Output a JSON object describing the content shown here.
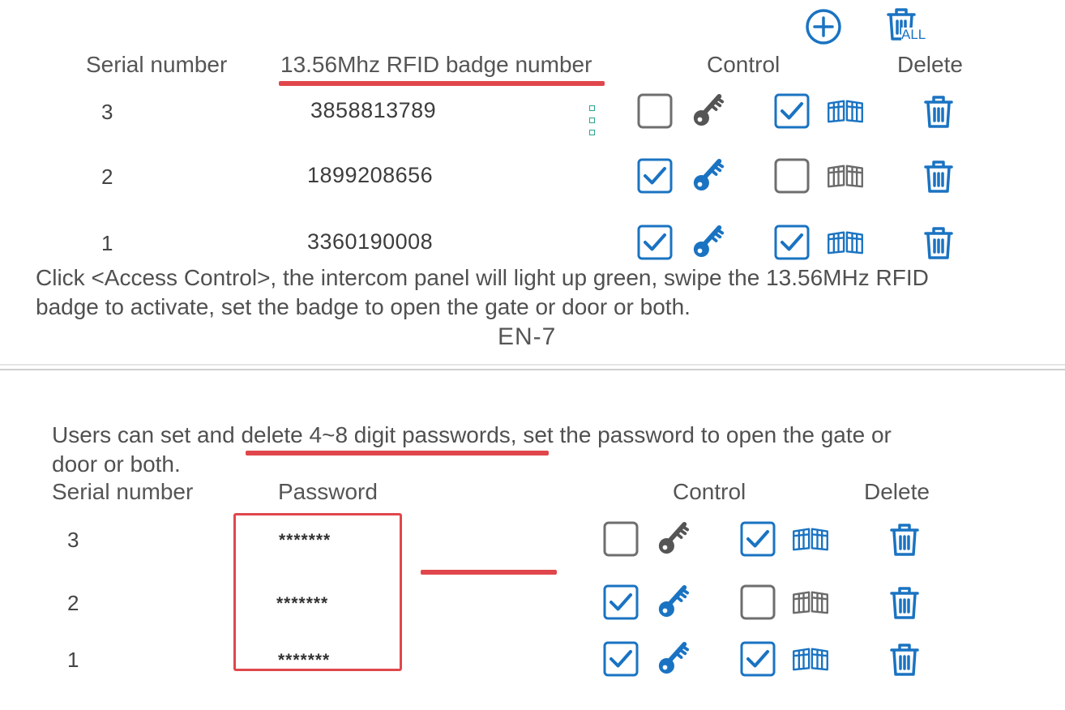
{
  "colors": {
    "accent": "#1a73c2",
    "inactive": "#6e6e6e",
    "annotation": "#e0474c"
  },
  "toolbar": {
    "add_icon": "plus-circle-icon",
    "delete_all_label": "ALL"
  },
  "rfid": {
    "headers": {
      "serial": "Serial number",
      "badge": "13.56Mhz RFID badge number",
      "control": "Control",
      "delete": "Delete"
    },
    "rows": [
      {
        "serial": "3",
        "badge": "3858813789",
        "key_checked": false,
        "gate_checked": true
      },
      {
        "serial": "2",
        "badge": "1899208656",
        "key_checked": true,
        "gate_checked": false
      },
      {
        "serial": "1",
        "badge": "3360190008",
        "key_checked": true,
        "gate_checked": true
      }
    ]
  },
  "instruction": {
    "line1": "Click <Access Control>, the intercom panel will light up green, swipe the 13.56MHz RFID",
    "line2": "badge to activate, set the badge to open the gate or door or both."
  },
  "page_number": "EN-7",
  "password_intro": {
    "line1_a": "Users can set and ",
    "line1_b": "delete 4~8 digit passwords",
    "line1_c": ", set the password to open the gate or",
    "line2": "door or both."
  },
  "passwords": {
    "headers": {
      "serial": "Serial number",
      "password": "Password",
      "control": "Control",
      "delete": "Delete"
    },
    "rows": [
      {
        "serial": "3",
        "password": "*******",
        "key_checked": false,
        "gate_checked": true
      },
      {
        "serial": "2",
        "password": "*******",
        "key_checked": true,
        "gate_checked": false
      },
      {
        "serial": "1",
        "password": "*******",
        "key_checked": true,
        "gate_checked": true
      }
    ]
  }
}
